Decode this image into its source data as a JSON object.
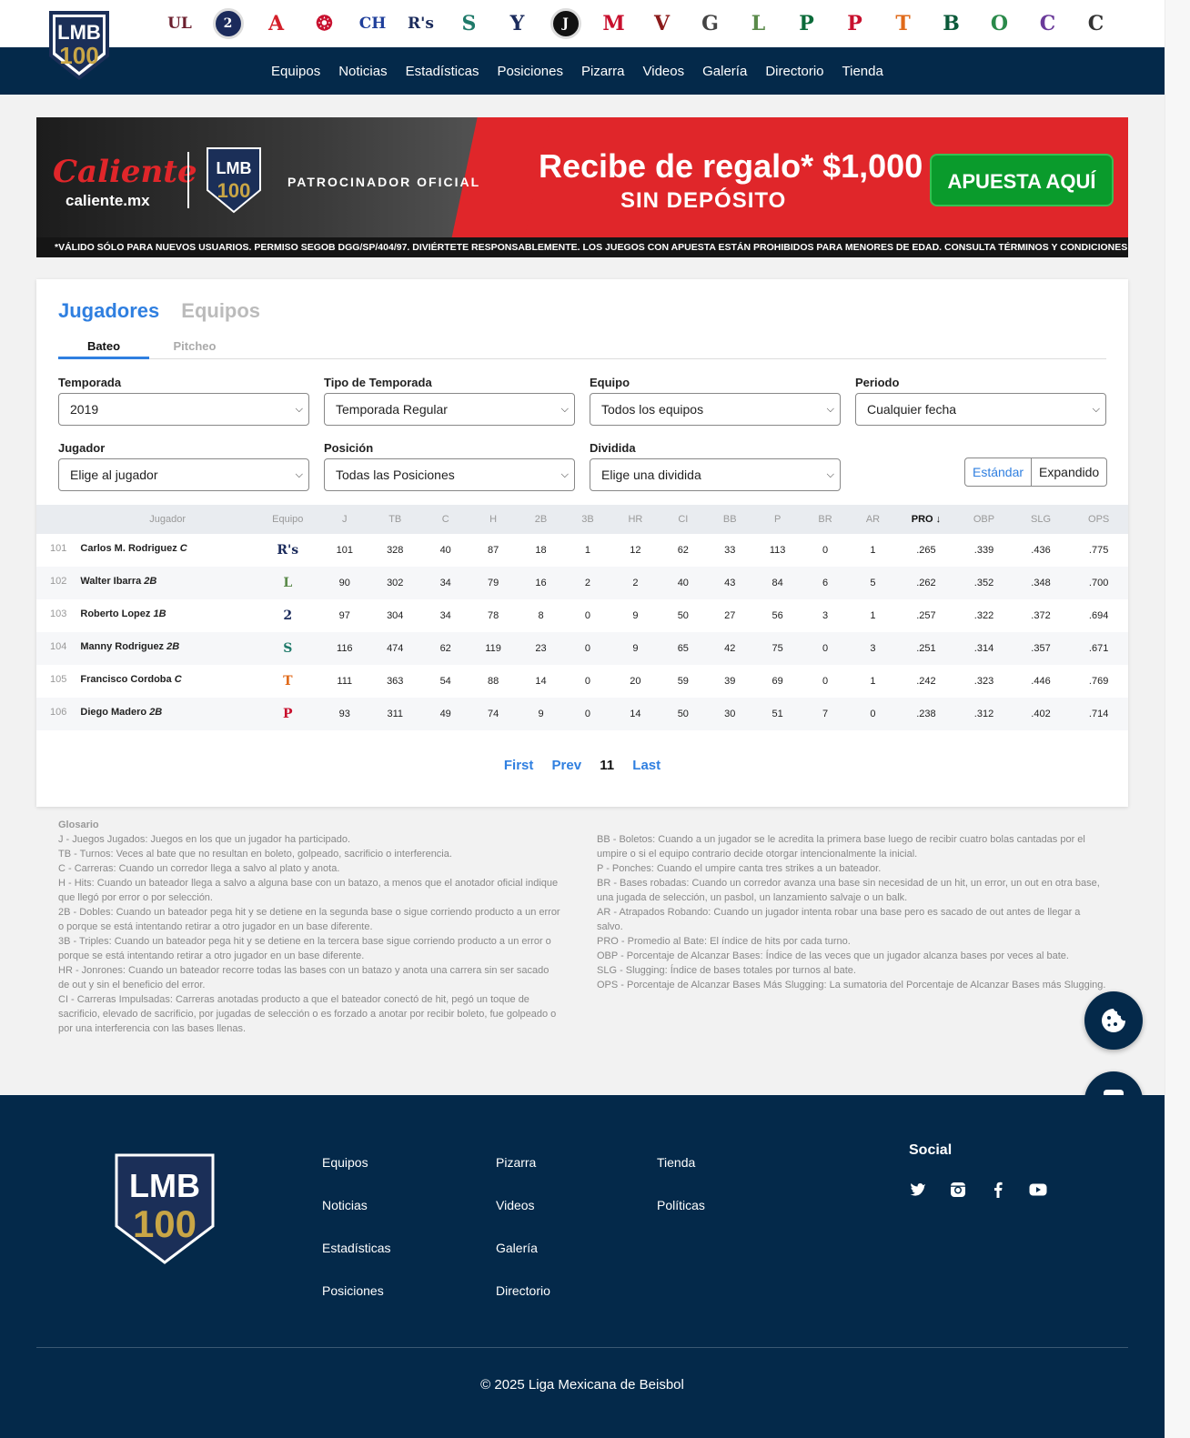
{
  "nav": {
    "items": [
      "Equipos",
      "Noticias",
      "Estadísticas",
      "Posiciones",
      "Pizarra",
      "Videos",
      "Galería",
      "Directorio",
      "Tienda"
    ]
  },
  "logo": {
    "line1": "LMB",
    "line2": "100"
  },
  "teams": [
    {
      "icon": "team-logo-1",
      "glyph": "UL",
      "color": "#6b1f2e"
    },
    {
      "icon": "team-logo-2",
      "glyph": "2",
      "color": "#1b2b5c"
    },
    {
      "icon": "team-logo-3",
      "glyph": "A",
      "color": "#d4202a"
    },
    {
      "icon": "team-logo-4",
      "glyph": "❂",
      "color": "#c8102e"
    },
    {
      "icon": "team-logo-5",
      "glyph": "CH",
      "color": "#1f3f9b"
    },
    {
      "icon": "team-logo-6",
      "glyph": "R's",
      "color": "#1b2b5c"
    },
    {
      "icon": "team-logo-7",
      "glyph": "S",
      "color": "#1f7a6a"
    },
    {
      "icon": "team-logo-8",
      "glyph": "Y",
      "color": "#1b2b5c"
    },
    {
      "icon": "team-logo-9",
      "glyph": "J",
      "color": "#111111"
    },
    {
      "icon": "team-logo-10",
      "glyph": "M",
      "color": "#c8102e"
    },
    {
      "icon": "team-logo-11",
      "glyph": "V",
      "color": "#8b1a1a"
    },
    {
      "icon": "team-logo-12",
      "glyph": "G",
      "color": "#444444"
    },
    {
      "icon": "team-logo-13",
      "glyph": "L",
      "color": "#5a8a4a"
    },
    {
      "icon": "team-logo-14",
      "glyph": "P",
      "color": "#0b6b3a"
    },
    {
      "icon": "team-logo-15",
      "glyph": "P",
      "color": "#c8102e"
    },
    {
      "icon": "team-logo-16",
      "glyph": "T",
      "color": "#e06a1a"
    },
    {
      "icon": "team-logo-17",
      "glyph": "B",
      "color": "#0b5a3a"
    },
    {
      "icon": "team-logo-18",
      "glyph": "O",
      "color": "#2a8a4a"
    },
    {
      "icon": "team-logo-19",
      "glyph": "C",
      "color": "#6a3a9a"
    },
    {
      "icon": "team-logo-20",
      "glyph": "C",
      "color": "#333333"
    }
  ],
  "banner": {
    "brand": "Caliente",
    "brand_sub": "caliente.mx",
    "sponsor": "PATROCINADOR OFICIAL",
    "promo_line1": "Recibe de regalo* $1,000",
    "promo_line2": "SIN DEPÓSITO",
    "cta": "APUESTA AQUÍ",
    "disclaimer": "*VÁLIDO SÓLO PARA NUEVOS USUARIOS. PERMISO SEGOB DGG/SP/404/97. DIVIÉRTETE RESPONSABLEMENTE. LOS JUEGOS CON APUESTA ESTÁN PROHIBIDOS PARA MENORES DE EDAD. CONSULTA TÉRMINOS Y CONDICIONES EN CALIENTE.MX"
  },
  "stats": {
    "tab_players": "Jugadores",
    "tab_teams": "Equipos",
    "subtab_batting": "Bateo",
    "subtab_pitching": "Pitcheo",
    "filters": {
      "temporada": {
        "label": "Temporada",
        "value": "2019"
      },
      "tipo": {
        "label": "Tipo de Temporada",
        "value": "Temporada Regular"
      },
      "equipo": {
        "label": "Equipo",
        "value": "Todos los equipos"
      },
      "periodo": {
        "label": "Periodo",
        "value": "Cualquier fecha"
      },
      "jugador": {
        "label": "Jugador",
        "value": "Elige al jugador"
      },
      "posicion": {
        "label": "Posición",
        "value": "Todas las Posiciones"
      },
      "dividida": {
        "label": "Dividida",
        "value": "Elige una dividida"
      }
    },
    "view_standard": "Estándar",
    "view_expanded": "Expandido",
    "columns": [
      "Jugador",
      "Equipo",
      "J",
      "TB",
      "C",
      "H",
      "2B",
      "3B",
      "HR",
      "CI",
      "BB",
      "P",
      "BR",
      "AR",
      "PRO",
      "OBP",
      "SLG",
      "OPS"
    ],
    "sorted_column": "PRO",
    "rows": [
      {
        "rank": "101",
        "name": "Carlos M. Rodriguez",
        "pos": "C",
        "team_icon": "team-logo-6",
        "team_glyph": "R's",
        "team_color": "#1b2b5c",
        "vals": [
          "101",
          "328",
          "40",
          "87",
          "18",
          "1",
          "12",
          "62",
          "33",
          "113",
          "0",
          "1",
          ".265",
          ".339",
          ".436",
          ".775"
        ]
      },
      {
        "rank": "102",
        "name": "Walter Ibarra",
        "pos": "2B",
        "team_icon": "team-logo-13",
        "team_glyph": "L",
        "team_color": "#5a8a4a",
        "vals": [
          "90",
          "302",
          "34",
          "79",
          "16",
          "2",
          "2",
          "40",
          "43",
          "84",
          "6",
          "5",
          ".262",
          ".352",
          ".348",
          ".700"
        ]
      },
      {
        "rank": "103",
        "name": "Roberto Lopez",
        "pos": "1B",
        "team_icon": "team-logo-2",
        "team_glyph": "2",
        "team_color": "#1b2b5c",
        "vals": [
          "97",
          "304",
          "34",
          "78",
          "8",
          "0",
          "9",
          "50",
          "27",
          "56",
          "3",
          "1",
          ".257",
          ".322",
          ".372",
          ".694"
        ]
      },
      {
        "rank": "104",
        "name": "Manny Rodriguez",
        "pos": "2B",
        "team_icon": "team-logo-7",
        "team_glyph": "S",
        "team_color": "#1f7a6a",
        "vals": [
          "116",
          "474",
          "62",
          "119",
          "23",
          "0",
          "9",
          "65",
          "42",
          "75",
          "0",
          "3",
          ".251",
          ".314",
          ".357",
          ".671"
        ]
      },
      {
        "rank": "105",
        "name": "Francisco Cordoba",
        "pos": "C",
        "team_icon": "team-logo-16",
        "team_glyph": "T",
        "team_color": "#e06a1a",
        "vals": [
          "111",
          "363",
          "54",
          "88",
          "14",
          "0",
          "20",
          "59",
          "39",
          "69",
          "0",
          "1",
          ".242",
          ".323",
          ".446",
          ".769"
        ]
      },
      {
        "rank": "106",
        "name": "Diego Madero",
        "pos": "2B",
        "team_icon": "team-logo-15",
        "team_glyph": "P",
        "team_color": "#c8102e",
        "vals": [
          "93",
          "311",
          "49",
          "74",
          "9",
          "0",
          "14",
          "50",
          "30",
          "51",
          "7",
          "0",
          ".238",
          ".312",
          ".402",
          ".714"
        ]
      }
    ],
    "pager": {
      "first": "First",
      "prev": "Prev",
      "current": "11",
      "last": "Last"
    }
  },
  "glossary": {
    "title": "Glosario",
    "left": [
      "J - Juegos Jugados: Juegos en los que un jugador ha participado.",
      "TB - Turnos: Veces al bate que no resultan en boleto, golpeado, sacrificio o interferencia.",
      "C - Carreras: Cuando un corredor llega a salvo al plato y anota.",
      "H - Hits: Cuando un bateador llega a salvo a alguna base con un batazo, a menos que el anotador oficial indique que llegó por error o por selección.",
      "2B - Dobles: Cuando un bateador pega hit y se detiene en la segunda base o sigue corriendo producto a un error o porque se está intentando retirar a otro jugador en un base diferente.",
      "3B - Triples: Cuando un bateador pega hit y se detiene en la tercera base sigue corriendo producto a un error o porque se está intentando retirar a otro jugador en un base diferente.",
      "HR - Jonrones: Cuando un bateador recorre todas las bases con un batazo y anota una carrera sin ser sacado de out y sin el beneficio del error.",
      "CI - Carreras Impulsadas: Carreras anotadas producto a que el bateador conectó de hit, pegó un toque de sacrificio, elevado de sacrificio, por jugadas de selección o es forzado a anotar por recibir boleto, fue golpeado o por una interferencia con las bases llenas."
    ],
    "right": [
      "BB - Boletos: Cuando a un jugador se le acredita la primera base luego de recibir cuatro bolas cantadas por el umpire o si el equipo contrario decide otorgar intencionalmente la inicial.",
      "P - Ponches: Cuando el umpire canta tres strikes a un bateador.",
      "BR - Bases robadas: Cuando un corredor avanza una base sin necesidad de un hit, un error, un out en otra base, una jugada de selección, un pasbol, un lanzamiento salvaje o un balk.",
      "AR - Atrapados Robando: Cuando un jugador intenta robar una base pero es sacado de out antes de llegar a salvo.",
      "PRO - Promedio al Bate: El índice de hits por cada turno.",
      "OBP - Porcentaje de Alcanzar Bases: Índice de las veces que un jugador alcanza bases por veces al bate.",
      "SLG - Slugging: Índice de bases totales por turnos al bate.",
      "OPS - Porcentaje de Alcanzar Bases Más Slugging: La sumatoria del Porcentaje de Alcanzar Bases más Slugging."
    ]
  },
  "footer": {
    "col1": [
      "Equipos",
      "Noticias",
      "Estadísticas",
      "Posiciones"
    ],
    "col2": [
      "Pizarra",
      "Videos",
      "Galería",
      "Directorio"
    ],
    "col3": [
      "Tienda",
      "Políticas"
    ],
    "social_title": "Social",
    "social_icons": [
      "twitter-icon",
      "instagram-icon",
      "facebook-icon",
      "youtube-icon"
    ],
    "copyright": "© 2025 Liga Mexicana de Beisbol"
  },
  "colors": {
    "navy": "#04294a",
    "accent": "#2f7fe0",
    "gold": "#c9a646"
  }
}
